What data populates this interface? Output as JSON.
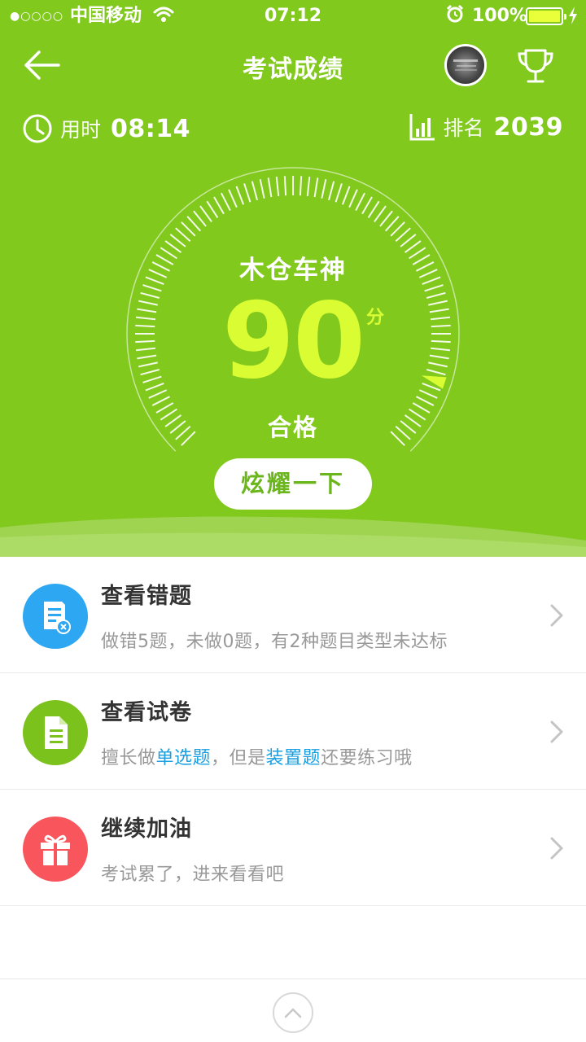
{
  "status_bar": {
    "signal": "●○○○○",
    "carrier": "中国移动",
    "time": "07:12",
    "battery": "100%"
  },
  "nav": {
    "title": "考试成绩"
  },
  "stats": {
    "time_label": "用时",
    "time_value": "08:14",
    "rank_label": "排名",
    "rank_value": "2039"
  },
  "result": {
    "user_name": "木仓车神",
    "score": "90",
    "score_unit": "分",
    "status": "合格",
    "gauge_level": 0.9
  },
  "share_button": "炫耀一下",
  "list": {
    "wrong": {
      "title": "查看错题",
      "subtitle": "做错5题，未做0题，有2种题目类型未达标"
    },
    "paper": {
      "title": "查看试卷",
      "sub_part1": "擅长做",
      "sub_hl1": "单选题",
      "sub_part2": "，但是",
      "sub_hl2": "装置题",
      "sub_part3": "还要练习哦"
    },
    "cheer": {
      "title": "继续加油",
      "subtitle": "考试累了，进来看看吧"
    }
  },
  "colors": {
    "hero_green": "#82c91e",
    "score_yellow": "#d9fc33",
    "link_blue": "#1aa0e0",
    "icon_blue": "#2ea7f2",
    "icon_green": "#7cc21c",
    "icon_red": "#f9555c"
  }
}
